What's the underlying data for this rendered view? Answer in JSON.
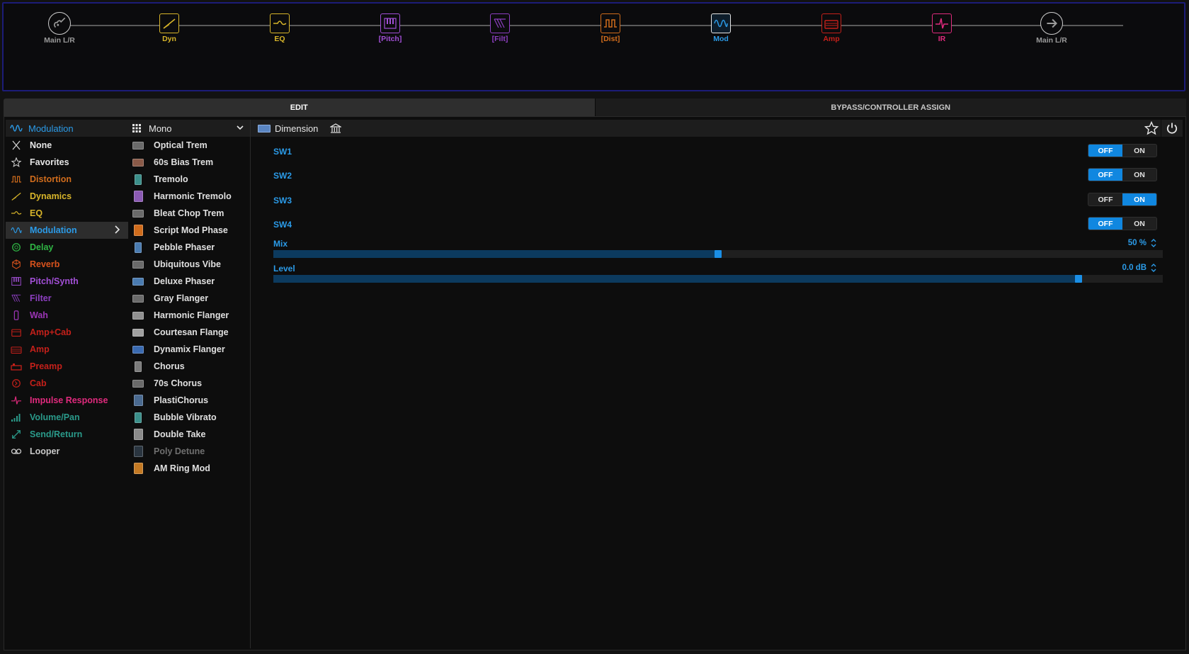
{
  "chain": {
    "nodes": [
      {
        "id": "in",
        "label": "Main L/R",
        "color": "#9a9a9a",
        "icon": "guitar-input-icon",
        "selected": false
      },
      {
        "id": "dyn",
        "label": "Dyn",
        "color": "#d8b52a",
        "icon": "dynamics-icon",
        "selected": false
      },
      {
        "id": "eq",
        "label": "EQ",
        "color": "#d8b52a",
        "icon": "eq-icon",
        "selected": false
      },
      {
        "id": "pitch",
        "label": "[Pitch]",
        "color": "#a24fd6",
        "icon": "pitch-icon",
        "selected": false
      },
      {
        "id": "filt",
        "label": "[Filt]",
        "color": "#8d3fc1",
        "icon": "filter-icon",
        "selected": false
      },
      {
        "id": "dist",
        "label": "[Dist]",
        "color": "#d06c1c",
        "icon": "distortion-icon",
        "selected": false
      },
      {
        "id": "mod",
        "label": "Mod",
        "color": "#2b9be8",
        "icon": "modulation-icon",
        "selected": true
      },
      {
        "id": "amp",
        "label": "Amp",
        "color": "#c4201a",
        "icon": "amp-icon",
        "selected": false
      },
      {
        "id": "ir",
        "label": "IR",
        "color": "#e02a7d",
        "icon": "impulse-response-icon",
        "selected": false
      },
      {
        "id": "out",
        "label": "Main L/R",
        "color": "#9a9a9a",
        "icon": "output-arrow-icon",
        "selected": false
      }
    ]
  },
  "tabs": {
    "edit": "EDIT",
    "bypass": "BYPASS/CONTROLLER ASSIGN"
  },
  "category_header": {
    "label": "Modulation",
    "color": "#2b9be8"
  },
  "model_header": {
    "label": "Mono"
  },
  "categories": [
    {
      "label": "None",
      "color": "#e6e6e6",
      "icon": "close-icon"
    },
    {
      "label": "Favorites",
      "color": "#e6e6e6",
      "icon": "star-icon"
    },
    {
      "label": "Distortion",
      "color": "#d06c1c",
      "icon": "distortion-icon"
    },
    {
      "label": "Dynamics",
      "color": "#d8b52a",
      "icon": "dynamics-icon"
    },
    {
      "label": "EQ",
      "color": "#d8b52a",
      "icon": "eq-icon"
    },
    {
      "label": "Modulation",
      "color": "#2b9be8",
      "icon": "modulation-icon",
      "active": true
    },
    {
      "label": "Delay",
      "color": "#2fb544",
      "icon": "delay-icon"
    },
    {
      "label": "Reverb",
      "color": "#d8521c",
      "icon": "reverb-icon"
    },
    {
      "label": "Pitch/Synth",
      "color": "#a24fd6",
      "icon": "pitch-icon"
    },
    {
      "label": "Filter",
      "color": "#8d3fc1",
      "icon": "filter-icon"
    },
    {
      "label": "Wah",
      "color": "#9b35b5",
      "icon": "wah-icon"
    },
    {
      "label": "Amp+Cab",
      "color": "#c4201a",
      "icon": "amp-cab-icon"
    },
    {
      "label": "Amp",
      "color": "#c4201a",
      "icon": "amp-icon"
    },
    {
      "label": "Preamp",
      "color": "#c4201a",
      "icon": "preamp-icon"
    },
    {
      "label": "Cab",
      "color": "#c4201a",
      "icon": "cab-icon"
    },
    {
      "label": "Impulse Response",
      "color": "#e02a7d",
      "icon": "impulse-response-icon"
    },
    {
      "label": "Volume/Pan",
      "color": "#2a9a8a",
      "icon": "volume-icon"
    },
    {
      "label": "Send/Return",
      "color": "#2a9a8a",
      "icon": "send-return-icon"
    },
    {
      "label": "Looper",
      "color": "#c8c8c8",
      "icon": "looper-icon"
    }
  ],
  "models": [
    {
      "label": "Optical Trem",
      "thumb": "#6a6a6a",
      "shape": "wide"
    },
    {
      "label": "60s Bias Trem",
      "thumb": "#8a5a48",
      "shape": "wide"
    },
    {
      "label": "Tremolo",
      "thumb": "#3b8f8a",
      "shape": "narrow"
    },
    {
      "label": "Harmonic Tremolo",
      "thumb": "#8b5ab3",
      "shape": "tall"
    },
    {
      "label": "Bleat Chop Trem",
      "thumb": "#6a6a6a",
      "shape": "wide"
    },
    {
      "label": "Script Mod Phase",
      "thumb": "#d06c1c",
      "shape": "tall"
    },
    {
      "label": "Pebble Phaser",
      "thumb": "#4a7bb0",
      "shape": "narrow"
    },
    {
      "label": "Ubiquitous Vibe",
      "thumb": "#6a6a6a",
      "shape": "wide"
    },
    {
      "label": "Deluxe Phaser",
      "thumb": "#4a7bb0",
      "shape": "wide"
    },
    {
      "label": "Gray Flanger",
      "thumb": "#6a6a6a",
      "shape": "wide"
    },
    {
      "label": "Harmonic Flanger",
      "thumb": "#909090",
      "shape": "wide"
    },
    {
      "label": "Courtesan Flange",
      "thumb": "#a0a0a0",
      "shape": "wide"
    },
    {
      "label": "Dynamix Flanger",
      "thumb": "#3a6ab0",
      "shape": "wide"
    },
    {
      "label": "Chorus",
      "thumb": "#7a7a7a",
      "shape": "narrow"
    },
    {
      "label": "70s Chorus",
      "thumb": "#6a6a6a",
      "shape": "wide"
    },
    {
      "label": "PlastiChorus",
      "thumb": "#4a6a90",
      "shape": "tall"
    },
    {
      "label": "Bubble Vibrato",
      "thumb": "#3b8f8a",
      "shape": "narrow"
    },
    {
      "label": "Double Take",
      "thumb": "#8a8a8a",
      "shape": "tall"
    },
    {
      "label": "Poly Detune",
      "thumb": "#2a3540",
      "shape": "tall",
      "dim": true
    },
    {
      "label": "AM Ring Mod",
      "thumb": "#c47a24",
      "shape": "tall"
    }
  ],
  "block": {
    "name": "Dimension"
  },
  "params": {
    "switches": [
      {
        "label": "SW1",
        "off": "OFF",
        "on": "ON",
        "state": "off"
      },
      {
        "label": "SW2",
        "off": "OFF",
        "on": "ON",
        "state": "off"
      },
      {
        "label": "SW3",
        "off": "OFF",
        "on": "ON",
        "state": "on"
      },
      {
        "label": "SW4",
        "off": "OFF",
        "on": "ON",
        "state": "off"
      }
    ],
    "sliders": [
      {
        "label": "Mix",
        "value_text": "50 %",
        "fraction": 0.5
      },
      {
        "label": "Level",
        "value_text": "0.0 dB",
        "fraction": 0.905
      }
    ]
  }
}
